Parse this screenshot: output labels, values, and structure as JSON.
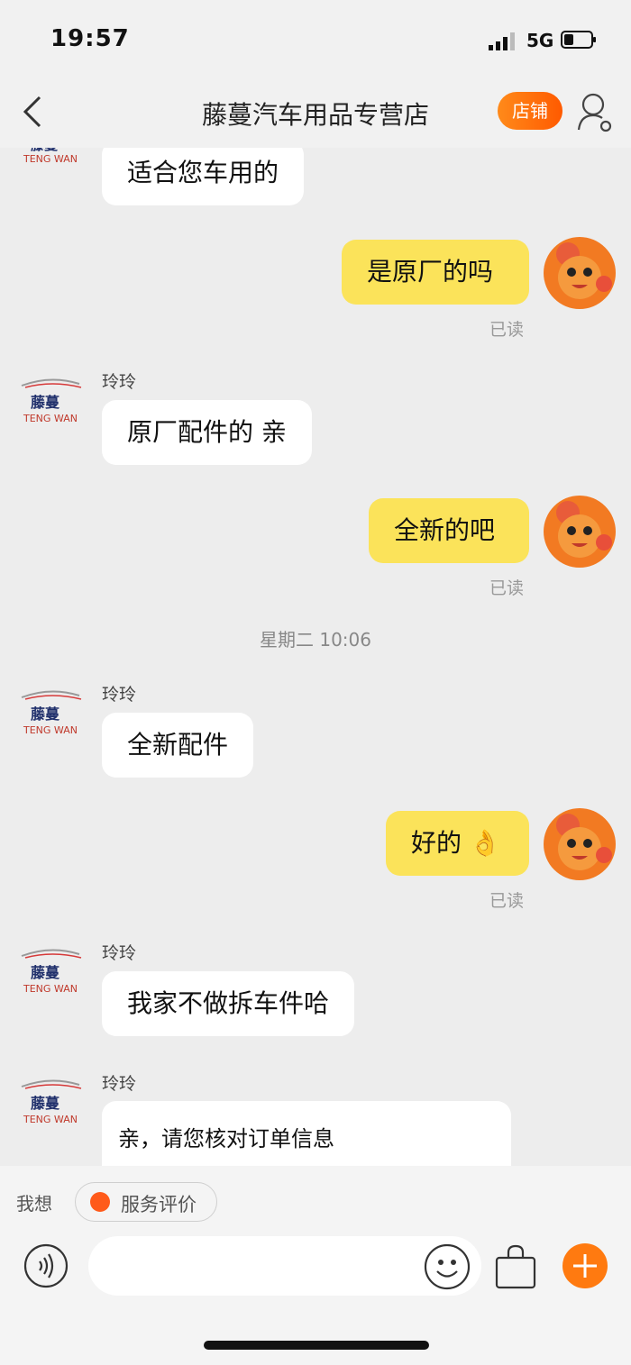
{
  "status": {
    "time": "19:57",
    "network": "5G"
  },
  "nav": {
    "title": "藤蔓汽车用品专营店",
    "shop_button": "店铺",
    "icons": [
      "back-icon",
      "user-settings-icon"
    ]
  },
  "shop_logo": {
    "cn": "藤蔓",
    "en": "TENG WAN"
  },
  "messages": [
    {
      "from": "shop",
      "text": "适合您车用的"
    },
    {
      "from": "me",
      "text": "是原厂的吗",
      "status": "已读"
    },
    {
      "from": "shop",
      "sender": "玲玲",
      "text": "原厂配件的 亲"
    },
    {
      "from": "me",
      "text": "全新的吧",
      "status": "已读"
    },
    {
      "timestamp": "星期二 10:06"
    },
    {
      "from": "shop",
      "sender": "玲玲",
      "text": "全新配件"
    },
    {
      "from": "me",
      "text": "好的",
      "emoji": "👌",
      "status": "已读"
    },
    {
      "from": "shop",
      "sender": "玲玲",
      "text": "我家不做拆车件哈"
    },
    {
      "from": "shop",
      "sender": "玲玲",
      "card_text": "亲，请您核对订单信息"
    }
  ],
  "bottom": {
    "want_label": "我想",
    "chip_label": "服务评价",
    "input_placeholder": "",
    "icons": [
      "voice-icon",
      "emoji-icon",
      "shopping-bag-icon",
      "plus-icon"
    ]
  },
  "colors": {
    "accent": "#ff6a00",
    "my_bubble": "#fbe35a",
    "background": "#ededed"
  }
}
